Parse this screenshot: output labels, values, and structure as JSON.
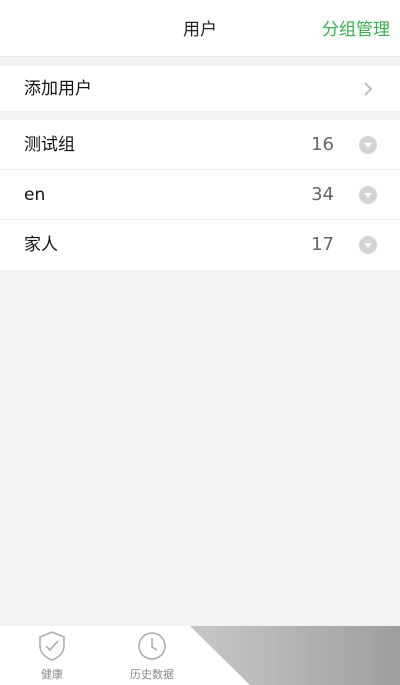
{
  "header": {
    "title": "用户",
    "manage_label": "分组管理"
  },
  "add_user": {
    "label": "添加用户",
    "icon": "chevron-right-icon"
  },
  "groups": [
    {
      "name": "测试组",
      "count": "16",
      "icon": "chevron-down-circle-icon"
    },
    {
      "name": "en",
      "count": "34",
      "icon": "chevron-down-circle-icon"
    },
    {
      "name": "家人",
      "count": "17",
      "icon": "chevron-down-circle-icon"
    }
  ],
  "tabs": [
    {
      "label": "健康",
      "icon": "shield-check-icon"
    },
    {
      "label": "历史数据",
      "icon": "clock-icon"
    }
  ],
  "colors": {
    "accent": "#33b24a",
    "background": "#f2f2f2"
  }
}
